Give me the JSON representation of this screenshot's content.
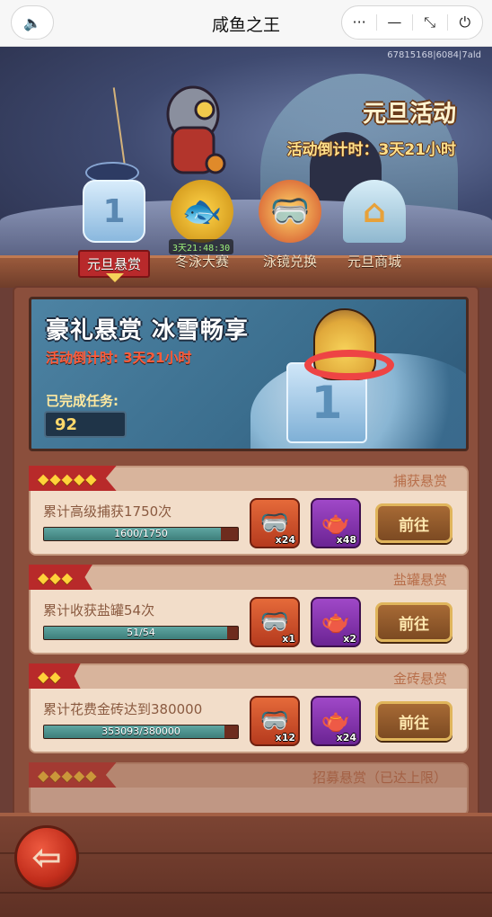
{
  "window": {
    "title": "咸鱼之王",
    "sound_icon": "speaker-icon",
    "capsule": {
      "more": "···",
      "minimize": "—",
      "collapse": "⤡",
      "close": "⏻"
    }
  },
  "banner": {
    "uid": "67815168|6084|7ald",
    "event_title": "元旦活动",
    "event_countdown": "活动倒计时：3天21小时"
  },
  "tabs": [
    {
      "label": "元旦悬赏",
      "icon": "ice-block-icon",
      "glyph": "1",
      "active": true
    },
    {
      "label": "冬泳大赛",
      "icon": "gold-fish-icon",
      "glyph": "🐟",
      "timer": "3天21:48:30"
    },
    {
      "label": "泳镜兑换",
      "icon": "goggles-icon",
      "glyph": "🥽"
    },
    {
      "label": "元旦商城",
      "icon": "igloo-icon",
      "glyph": "⌂"
    }
  ],
  "hero": {
    "title": "豪礼悬赏 冰雪畅享",
    "countdown": "活动倒计时: 3天21小时",
    "done_label": "已完成任务:",
    "done_value": "92"
  },
  "quests": [
    {
      "stars": 5,
      "category": "捕获悬赏",
      "desc": "累计高级捕获1750次",
      "current": 1600,
      "total": 1750,
      "progress_text": "1600/1750",
      "reward1": "x24",
      "reward2": "x48",
      "button": "前往"
    },
    {
      "stars": 3,
      "category": "盐罐悬赏",
      "desc": "累计收获盐罐54次",
      "current": 51,
      "total": 54,
      "progress_text": "51/54",
      "reward1": "x1",
      "reward2": "x2",
      "button": "前往"
    },
    {
      "stars": 2,
      "category": "金砖悬赏",
      "desc": "累计花费金砖达到380000",
      "current": 353093,
      "total": 380000,
      "progress_text": "353093/380000",
      "reward1": "x12",
      "reward2": "x24",
      "button": "前往"
    },
    {
      "stars": 5,
      "category": "招募悬赏（已达上限）",
      "desc": ""
    }
  ],
  "colors": {
    "accent_red": "#b82a2a",
    "progress": "#4f9592",
    "panel": "#8b4f3c"
  }
}
